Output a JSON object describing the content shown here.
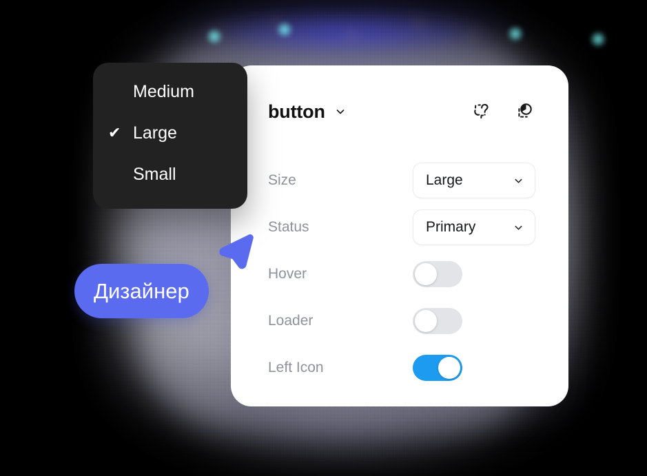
{
  "panel": {
    "title": "button",
    "title_chevron_icon": "chevron-down-icon",
    "header_icons": [
      {
        "name": "reset-properties-icon"
      },
      {
        "name": "swap-component-icon"
      }
    ],
    "rows": [
      {
        "label": "Size",
        "control": "select",
        "value": "Large",
        "chevron_icon": "chevron-down-icon"
      },
      {
        "label": "Status",
        "control": "select",
        "value": "Primary",
        "chevron_icon": "chevron-down-icon"
      },
      {
        "label": "Hover",
        "control": "toggle",
        "value": "off"
      },
      {
        "label": "Loader",
        "control": "toggle",
        "value": "off"
      },
      {
        "label": "Left Icon",
        "control": "toggle",
        "value": "on"
      }
    ]
  },
  "dropdown_menu": {
    "items": [
      {
        "label": "Medium",
        "checked": false,
        "check_icon": ""
      },
      {
        "label": "Large",
        "checked": true,
        "check_icon": "✔"
      },
      {
        "label": "Small",
        "checked": false,
        "check_icon": ""
      }
    ]
  },
  "cursor": {
    "name": "Дизайнер",
    "pointer_icon": "cursor-arrow-icon"
  },
  "colors": {
    "accent_toggle_on": "#1d9bf0",
    "cursor_badge": "#5b6bf0",
    "menu_background": "#222222",
    "panel_background": "#ffffff",
    "label_text": "#8d929b",
    "value_text": "#14161a"
  }
}
